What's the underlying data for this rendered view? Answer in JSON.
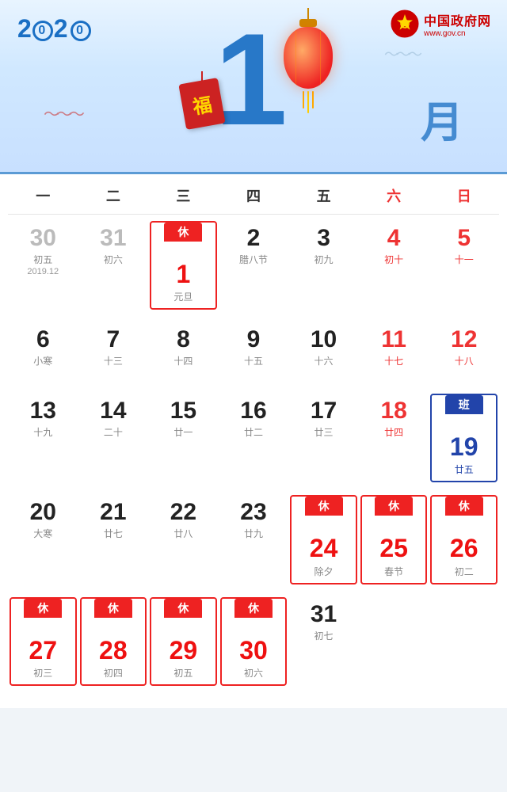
{
  "header": {
    "year": "2020",
    "month": "1",
    "month_char": "月",
    "gov_name": "中国政府网",
    "gov_url": "www.gov.cn"
  },
  "weekdays": [
    {
      "label": "一",
      "is_weekend": false
    },
    {
      "label": "二",
      "is_weekend": false
    },
    {
      "label": "三",
      "is_weekend": false
    },
    {
      "label": "四",
      "is_weekend": false
    },
    {
      "label": "五",
      "is_weekend": false
    },
    {
      "label": "六",
      "is_weekend": true
    },
    {
      "label": "日",
      "is_weekend": true
    }
  ],
  "days": [
    {
      "num": "30",
      "lunar": "初五",
      "prev": true,
      "col": 1
    },
    {
      "num": "31",
      "lunar": "初六",
      "prev": true,
      "col": 2
    },
    {
      "num": "1",
      "lunar": "元旦",
      "badge": "休",
      "badge_type": "rest",
      "col": 3
    },
    {
      "num": "2",
      "lunar": "腊八节",
      "col": 4
    },
    {
      "num": "3",
      "lunar": "初九",
      "col": 5
    },
    {
      "num": "4",
      "lunar": "初十",
      "weekend": true,
      "col": 6
    },
    {
      "num": "5",
      "lunar": "十一",
      "weekend": true,
      "col": 7
    },
    {
      "num": "6",
      "lunar": "小寒",
      "col": 1
    },
    {
      "num": "7",
      "lunar": "十三",
      "col": 2
    },
    {
      "num": "8",
      "lunar": "十四",
      "col": 3
    },
    {
      "num": "9",
      "lunar": "十五",
      "col": 4
    },
    {
      "num": "10",
      "lunar": "十六",
      "col": 5
    },
    {
      "num": "11",
      "lunar": "十七",
      "weekend": true,
      "col": 6
    },
    {
      "num": "12",
      "lunar": "十八",
      "weekend": true,
      "col": 7
    },
    {
      "num": "13",
      "lunar": "十九",
      "col": 1
    },
    {
      "num": "14",
      "lunar": "二十",
      "col": 2
    },
    {
      "num": "15",
      "lunar": "廿一",
      "col": 3
    },
    {
      "num": "16",
      "lunar": "廿二",
      "col": 4
    },
    {
      "num": "17",
      "lunar": "廿三",
      "col": 5
    },
    {
      "num": "18",
      "lunar": "廿四",
      "weekend": true,
      "col": 6
    },
    {
      "num": "19",
      "lunar": "廿五",
      "badge": "班",
      "badge_type": "work",
      "weekend": true,
      "col": 7
    },
    {
      "num": "20",
      "lunar": "大寒",
      "col": 1
    },
    {
      "num": "21",
      "lunar": "廿七",
      "col": 2
    },
    {
      "num": "22",
      "lunar": "廿八",
      "col": 3
    },
    {
      "num": "23",
      "lunar": "廿九",
      "col": 4
    },
    {
      "num": "24",
      "lunar": "除夕",
      "badge": "休",
      "badge_type": "rest",
      "col": 5
    },
    {
      "num": "25",
      "lunar": "春节",
      "badge": "休",
      "badge_type": "rest",
      "weekend": true,
      "col": 6
    },
    {
      "num": "26",
      "lunar": "初二",
      "badge": "休",
      "badge_type": "rest",
      "weekend": true,
      "col": 7
    },
    {
      "num": "27",
      "lunar": "初三",
      "badge": "休",
      "badge_type": "rest",
      "col": 1
    },
    {
      "num": "28",
      "lunar": "初四",
      "badge": "休",
      "badge_type": "rest",
      "col": 2
    },
    {
      "num": "29",
      "lunar": "初五",
      "badge": "休",
      "badge_type": "rest",
      "col": 3
    },
    {
      "num": "30",
      "lunar": "初六",
      "badge": "休",
      "badge_type": "rest",
      "col": 4
    },
    {
      "num": "31",
      "lunar": "初七",
      "col": 5
    }
  ],
  "prev_year_month": "2019.12",
  "badges": {
    "rest": "休",
    "work": "班"
  }
}
